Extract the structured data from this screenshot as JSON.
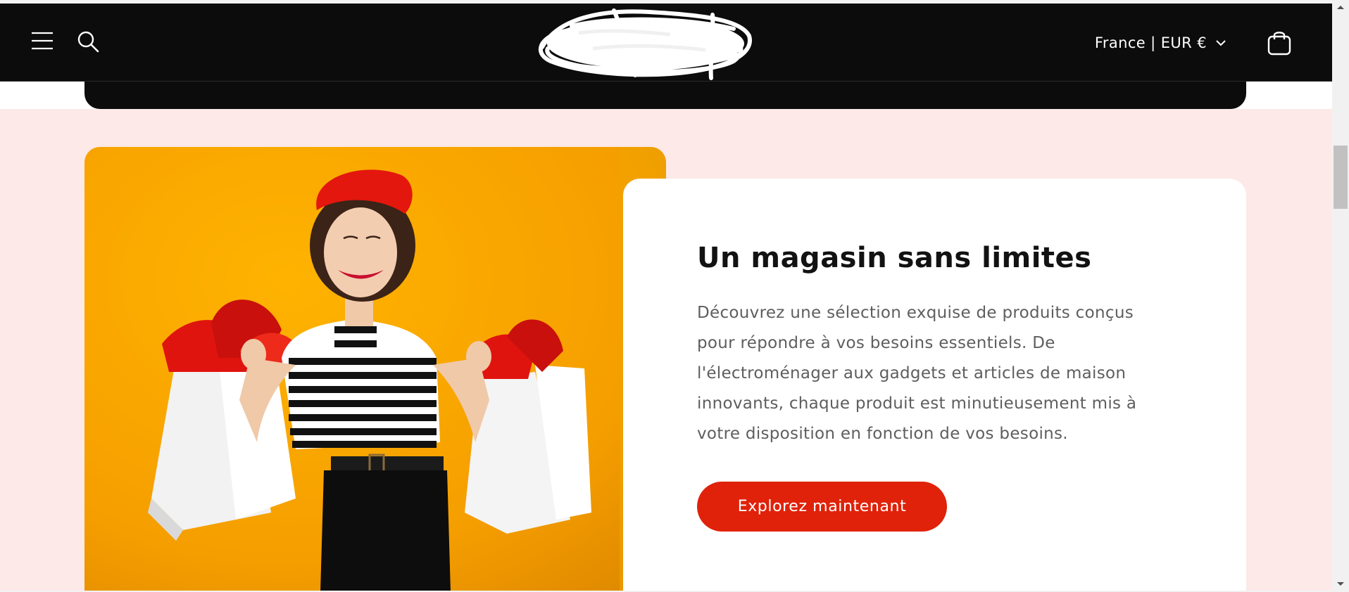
{
  "header": {
    "menu_icon": "hamburger-menu-icon",
    "search_icon": "search-icon",
    "logo": "scribbled-out-logo",
    "country_selector": {
      "label": "France | EUR €",
      "icon": "chevron-down-icon"
    },
    "cart_icon": "shopping-bag-icon"
  },
  "promo": {
    "image": "woman-in-red-beret-holding-shopping-bags",
    "title": "Un magasin sans limites",
    "text": "Découvrez une sélection exquise de produits conçus pour répondre à vos besoins essentiels. De l'électroménager aux gadgets et articles de maison innovants, chaque produit est minutieusement mis à votre disposition en fonction de vos besoins.",
    "button_label": "Explorez maintenant"
  },
  "colors": {
    "header_bg": "#0c0c0c",
    "section_bg": "#fce9e8",
    "button_bg": "#e0220a",
    "photo_bg": "#f7a400"
  },
  "scrollbar": {
    "icon_up": "scroll-up-arrow-icon",
    "icon_down": "scroll-down-arrow-icon"
  }
}
